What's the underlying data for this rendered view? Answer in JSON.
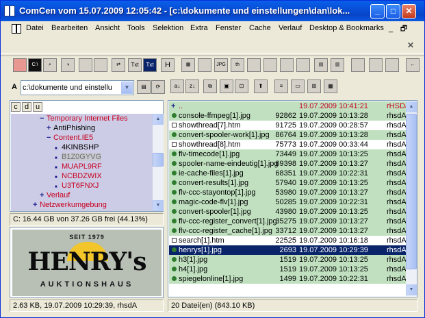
{
  "window": {
    "title": "ComCen vom 15.07.2009 12:05:42 - [c:\\dokumente und einstellungen\\dan\\lok...",
    "min_label": "_",
    "max_label": "□",
    "close_label": "✕"
  },
  "menu": {
    "items": [
      "Datei",
      "Bearbeiten",
      "Ansicht",
      "Tools",
      "Selektion",
      "Extra",
      "Fenster",
      "Cache",
      "Verlauf",
      "Desktop & Bookmarks"
    ],
    "mdi_min": "_",
    "mdi_restore": "🗗",
    "mdi_close": "✕"
  },
  "toolbar": {
    "tools": [
      "delete-tool",
      "cmd-tool",
      "search-tool",
      "disc-tool",
      "split-tool",
      "dos-tool",
      "copy-tool",
      "txt-tool",
      "txt-edit-tool",
      "hex-tool",
      "network-tool",
      "compare-tool",
      "jpg-tool",
      "thumb-tool",
      "info-tool",
      "info2-tool",
      "info3-tool",
      "info4-tool",
      "grid-tool",
      "grid2-tool",
      "panel-tool",
      "panel2-tool",
      "panel3-tool",
      "back-tool"
    ],
    "labels": {
      "cmd": "C:\\",
      "txt": "Txt",
      "txt2": "Txt",
      "hex": "H",
      "jpg": "JPG",
      "thumb": "th"
    }
  },
  "left": {
    "drive_letter": "A",
    "path_value": "c:\\dokumente und einstellu",
    "drive_tabs": [
      "c",
      "d",
      "u"
    ],
    "tree": [
      {
        "sign": "−",
        "label": "Temporary Internet Files",
        "color": "red",
        "indent": 0
      },
      {
        "sign": "+",
        "label": "AntiPhishing",
        "color": "black",
        "indent": 1
      },
      {
        "sign": "−",
        "label": "Content.IE5",
        "color": "red",
        "indent": 1
      },
      {
        "sign": "■",
        "label": "4KINBSHP",
        "color": "black",
        "indent": 2
      },
      {
        "sign": "■",
        "label": "B1Z0GYVG",
        "color": "gray",
        "indent": 2
      },
      {
        "sign": "■",
        "label": "MUAPL9RF",
        "color": "red",
        "indent": 2
      },
      {
        "sign": "■",
        "label": "NCBDZWIX",
        "color": "red",
        "indent": 2
      },
      {
        "sign": "■",
        "label": "U3T6FNXJ",
        "color": "red",
        "indent": 2
      },
      {
        "sign": "+",
        "label": "Verlauf",
        "color": "red",
        "indent": 0
      },
      {
        "sign": "+",
        "label": "Netzwerkumgebung",
        "color": "red",
        "indent": -1
      }
    ],
    "disk_info": "C: 16.44 GB von 37.26 GB frei (44.13%)",
    "preview": {
      "line1": "SEIT 1979",
      "name": "HENRY's",
      "line2": "AUKTIONSHAUS"
    },
    "file_info": "2.63 KB, 19.07.2009 10:29:39, rhsdA"
  },
  "right": {
    "files": [
      {
        "icon": "up",
        "name": "..",
        "size": "",
        "date": "19.07.2009 10:41:21",
        "attr": "rHSDa",
        "style": "updir"
      },
      {
        "icon": "dot",
        "name": "console-ffmpeg[1].jpg",
        "size": "92862",
        "date": "19.07.2009 10:13:28",
        "attr": "rhsdA",
        "style": "green"
      },
      {
        "icon": "box",
        "name": "showthread[7].htm",
        "size": "91725",
        "date": "19.07.2009 00:28:57",
        "attr": "rhsdA",
        "style": "white"
      },
      {
        "icon": "dot",
        "name": "convert-spooler-work[1].jpg",
        "size": "86764",
        "date": "19.07.2009 10:13:28",
        "attr": "rhsdA",
        "style": "green"
      },
      {
        "icon": "box",
        "name": "showthread[8].htm",
        "size": "75773",
        "date": "19.07.2009 00:33:44",
        "attr": "rhsdA",
        "style": "white"
      },
      {
        "icon": "dot",
        "name": "flv-timecode[1].jpg",
        "size": "73449",
        "date": "19.07.2009 10:13:25",
        "attr": "rhsdA",
        "style": "green"
      },
      {
        "icon": "dot",
        "name": "spooler-name-eindeutig[1].jpg",
        "size": "69398",
        "date": "19.07.2009 10:13:27",
        "attr": "rhsdA",
        "style": "green"
      },
      {
        "icon": "dot",
        "name": "ie-cache-files[1].jpg",
        "size": "68351",
        "date": "19.07.2009 10:22:31",
        "attr": "rhsdA",
        "style": "green"
      },
      {
        "icon": "dot",
        "name": "convert-results[1].jpg",
        "size": "57940",
        "date": "19.07.2009 10:13:25",
        "attr": "rhsdA",
        "style": "green"
      },
      {
        "icon": "dot",
        "name": "flv-ccc-stayontop[1].jpg",
        "size": "53980",
        "date": "19.07.2009 10:13:27",
        "attr": "rhsdA",
        "style": "green"
      },
      {
        "icon": "dot",
        "name": "magic-code-flv[1].jpg",
        "size": "50285",
        "date": "19.07.2009 10:22:31",
        "attr": "rhsdA",
        "style": "green"
      },
      {
        "icon": "dot",
        "name": "convert-spooler[1].jpg",
        "size": "43980",
        "date": "19.07.2009 10:13:25",
        "attr": "rhsdA",
        "style": "green"
      },
      {
        "icon": "dot",
        "name": "flv-ccc-register_convert[1].jpg",
        "size": "35275",
        "date": "19.07.2009 10:13:27",
        "attr": "rhsdA",
        "style": "green"
      },
      {
        "icon": "dot",
        "name": "flv-ccc-register_cache[1].jpg",
        "size": "33712",
        "date": "19.07.2009 10:13:27",
        "attr": "rhsdA",
        "style": "green"
      },
      {
        "icon": "box",
        "name": "search[1].htm",
        "size": "22525",
        "date": "19.07.2009 10:16:18",
        "attr": "rhsdA",
        "style": "white"
      },
      {
        "icon": "dot",
        "name": "henrys[1].jpg",
        "size": "2693",
        "date": "19.07.2009 10:29:39",
        "attr": "rhsdA",
        "style": "sel"
      },
      {
        "icon": "dot",
        "name": "h3[1].jpg",
        "size": "1519",
        "date": "19.07.2009 10:13:25",
        "attr": "rhsdA",
        "style": "green"
      },
      {
        "icon": "dot",
        "name": "h4[1].jpg",
        "size": "1519",
        "date": "19.07.2009 10:13:25",
        "attr": "rhsdA",
        "style": "green"
      },
      {
        "icon": "dot",
        "name": "spiegelonline[1].jpg",
        "size": "1499",
        "date": "19.07.2009 10:22:31",
        "attr": "rhsdA",
        "style": "green"
      }
    ],
    "status": "20 Datei(en) (843.10 KB)"
  }
}
